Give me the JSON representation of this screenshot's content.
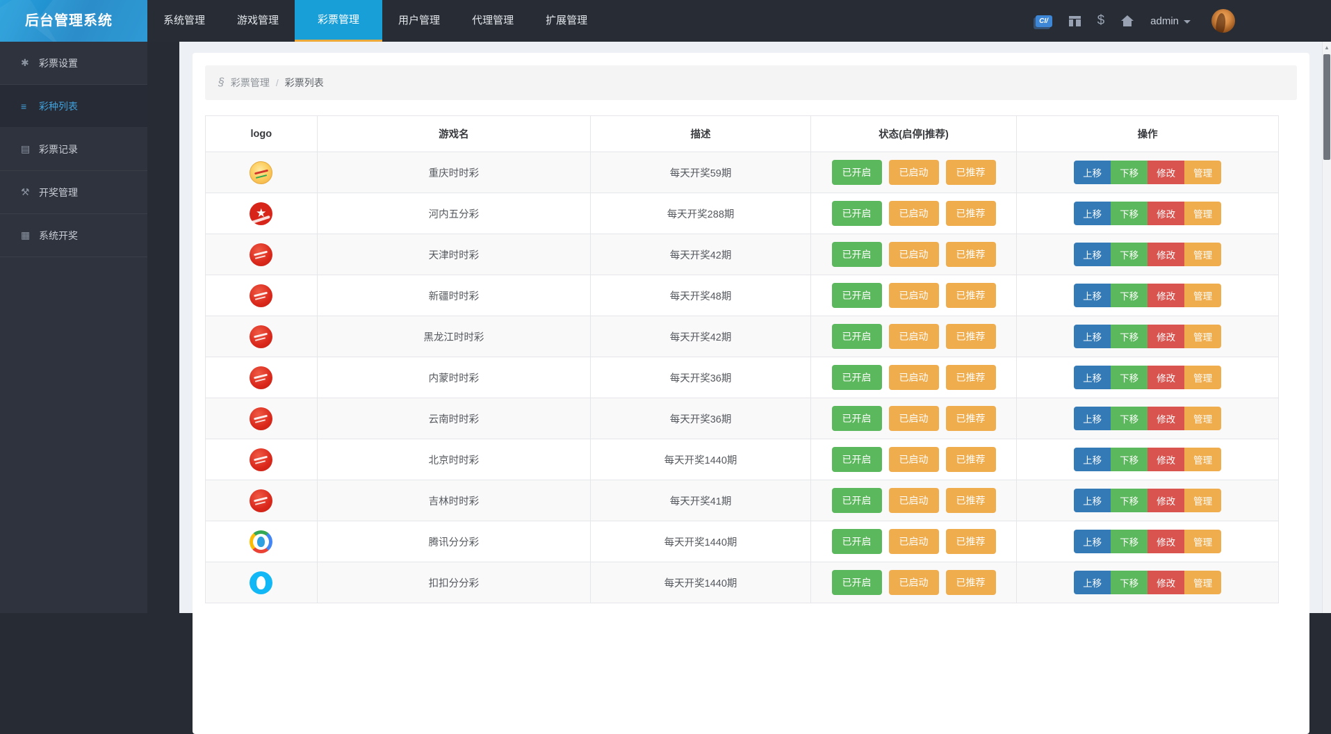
{
  "navbar": {
    "brand": "后台管理系统",
    "menu": [
      {
        "label": "系统管理",
        "active": false
      },
      {
        "label": "游戏管理",
        "active": false
      },
      {
        "label": "彩票管理",
        "active": true
      },
      {
        "label": "用户管理",
        "active": false
      },
      {
        "label": "代理管理",
        "active": false
      },
      {
        "label": "扩展管理",
        "active": false
      }
    ],
    "right_icons": [
      {
        "name": "ci-badge-icon",
        "glyph": "CI/"
      },
      {
        "name": "gift-icon",
        "glyph": ""
      },
      {
        "name": "dollar-icon",
        "glyph": "$"
      },
      {
        "name": "home-icon",
        "glyph": ""
      }
    ],
    "user": {
      "label": "admin"
    }
  },
  "sidebar": {
    "items": [
      {
        "label": "彩票设置",
        "icon": "asterisk-icon",
        "glyph": "✱",
        "active": false
      },
      {
        "label": "彩种列表",
        "icon": "list-icon",
        "glyph": "≡",
        "active": true
      },
      {
        "label": "彩票记录",
        "icon": "book-icon",
        "glyph": "▤",
        "active": false
      },
      {
        "label": "开奖管理",
        "icon": "gavel-icon",
        "glyph": "⚒",
        "active": false
      },
      {
        "label": "系统开奖",
        "icon": "server-icon",
        "glyph": "▦",
        "active": false
      }
    ]
  },
  "breadcrumb": {
    "section": "彩票管理",
    "separator": "/",
    "current": "彩票列表"
  },
  "table": {
    "headers": [
      "logo",
      "游戏名",
      "描述",
      "状态(启停|推荐)",
      "操作"
    ],
    "status_buttons": [
      {
        "key": "enabled",
        "label": "已开启",
        "color": "#5cb85c"
      },
      {
        "key": "started",
        "label": "已启动",
        "color": "#f0ad4e"
      },
      {
        "key": "recommended",
        "label": "已推荐",
        "color": "#f0ad4e"
      }
    ],
    "action_buttons": [
      {
        "key": "move-up",
        "label": "上移",
        "color": "#337ab7"
      },
      {
        "key": "move-down",
        "label": "下移",
        "color": "#5cb85c"
      },
      {
        "key": "edit",
        "label": "修改",
        "color": "#d9534f"
      },
      {
        "key": "manage",
        "label": "管理",
        "color": "#f0ad4e"
      }
    ],
    "rows": [
      {
        "name": "重庆时时彩",
        "desc": "每天开奖59期",
        "logo": "gold-ssc"
      },
      {
        "name": "河内五分彩",
        "desc": "每天开奖288期",
        "logo": "red-star"
      },
      {
        "name": "天津时时彩",
        "desc": "每天开奖42期",
        "logo": "red-ssc"
      },
      {
        "name": "新疆时时彩",
        "desc": "每天开奖48期",
        "logo": "red-ssc"
      },
      {
        "name": "黑龙江时时彩",
        "desc": "每天开奖42期",
        "logo": "red-ssc"
      },
      {
        "name": "内蒙时时彩",
        "desc": "每天开奖36期",
        "logo": "red-ssc"
      },
      {
        "name": "云南时时彩",
        "desc": "每天开奖36期",
        "logo": "red-ssc"
      },
      {
        "name": "北京时时彩",
        "desc": "每天开奖1440期",
        "logo": "red-ssc"
      },
      {
        "name": "吉林时时彩",
        "desc": "每天开奖41期",
        "logo": "red-ssc"
      },
      {
        "name": "腾讯分分彩",
        "desc": "每天开奖1440期",
        "logo": "tencent"
      },
      {
        "name": "扣扣分分彩",
        "desc": "每天开奖1440期",
        "logo": "qq"
      }
    ]
  },
  "colors": {
    "nav_active": "#199fd8",
    "nav_active_underline": "#eca93c",
    "green": "#5cb85c",
    "orange": "#f0ad4e",
    "red": "#d9534f",
    "blue": "#337ab7",
    "qq_blue": "#12b7f5"
  }
}
